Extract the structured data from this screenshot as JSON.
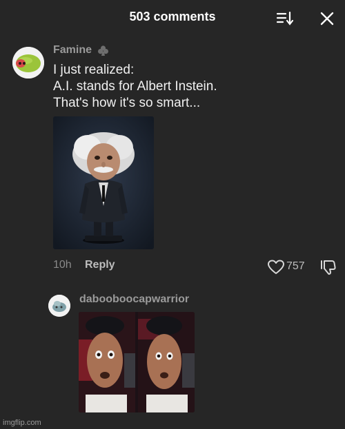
{
  "header": {
    "title": "503 comments",
    "sort_icon": "sort-icon",
    "close_icon": "close-icon"
  },
  "comment": {
    "username": "Famine",
    "badge_icon": "club-icon",
    "text_lines": [
      "I just realized:",
      "A.I. stands for Albert Instein.",
      "That's how it's so smart..."
    ],
    "time": "10h",
    "reply_label": "Reply",
    "like_count": "757",
    "like_icon": "heart-icon",
    "dislike_icon": "thumbs-down-icon"
  },
  "reply": {
    "username": "dabooboocapwarrior"
  },
  "watermark": "imgflip.com",
  "colors": {
    "background": "#262626",
    "username": "#9a9a9a",
    "text": "#f0f0f0"
  }
}
